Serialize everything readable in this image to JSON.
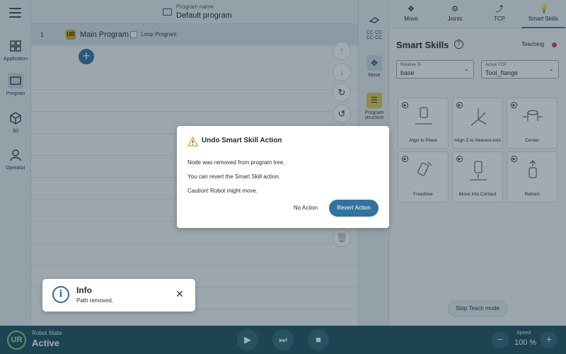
{
  "nav": {
    "items": [
      {
        "label": "Application",
        "icon": "grid-icon"
      },
      {
        "label": "Program",
        "icon": "program-icon"
      },
      {
        "label": "3D",
        "icon": "cube-icon"
      },
      {
        "label": "Operator",
        "icon": "user-icon"
      }
    ]
  },
  "program": {
    "name_label": "Program name",
    "name": "Default program",
    "row_number": "1",
    "main_label": "Main Program",
    "logo_text": "UR",
    "loop_label": "Loop Program"
  },
  "mid": {
    "cc_label_1": "CC CC",
    "cc_label_2": "CC CC",
    "move_label": "Move",
    "structure_label_1": "Program",
    "structure_label_2": "structure"
  },
  "tabs": [
    {
      "label": "Move",
      "icon": "move-icon"
    },
    {
      "label": "Joints",
      "icon": "joints-icon"
    },
    {
      "label": "TCP",
      "icon": "tcp-icon"
    },
    {
      "label": "Smart Skills",
      "icon": "bulb-icon"
    }
  ],
  "smart_skills": {
    "title": "Smart Skills",
    "help": "?",
    "teaching": "Teaching",
    "relative_to_label": "Relative To",
    "relative_to_value": "base",
    "active_tcp_label": "Active TCP",
    "active_tcp_value": "Tool_flange",
    "skills": [
      "Align to Plane",
      "Align Z to Nearest Axis",
      "Center",
      "Freedrive",
      "Move Into Contact",
      "Retract"
    ],
    "stop_teach": "Stop Teach mode"
  },
  "bottom": {
    "robot_state_label": "Robot State",
    "robot_state_value": "Active",
    "speed_label": "Speed",
    "speed_value": "100 %",
    "logo_text": "UR"
  },
  "dialog": {
    "title": "Undo Smart Skill Action",
    "line1": "Node was removed from program tree.",
    "line2": "You can revert the Smart Skill action.",
    "line3": "Caution! Robot might move.",
    "no_action": "No Action",
    "revert": "Revert Action"
  },
  "toast": {
    "title": "Info",
    "message": "Path removed.",
    "icon_glyph": "i"
  },
  "colors": {
    "accent": "#33739e",
    "bottom_bar": "#1e4f5e",
    "teaching_dot": "#d43c3c",
    "warning": "#e2a31b"
  }
}
